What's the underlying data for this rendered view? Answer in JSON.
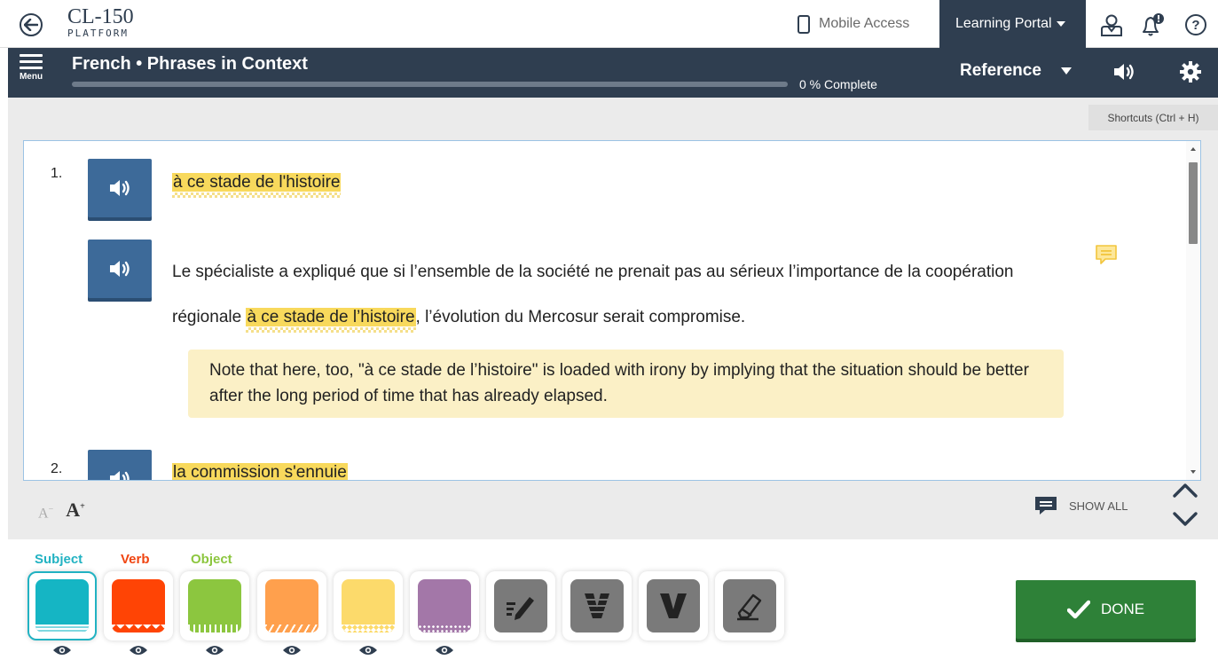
{
  "app": {
    "logo_main": "CL-150",
    "logo_sub": "PLATFORM",
    "mobile_access": "Mobile Access",
    "learning_portal": "Learning Portal"
  },
  "title_bar": {
    "menu_label": "Menu",
    "course_title": "French • Phrases in Context",
    "progress_percent": 0,
    "progress_text": "0 % Complete",
    "reference_label": "Reference"
  },
  "workspace": {
    "shortcuts": "Shortcuts (Ctrl + H)",
    "items": [
      {
        "number": "1.",
        "phrase": "à ce stade de l'histoire",
        "sentence_before": "Le spécialiste a expliqué que si l’ensemble de la société ne prenait pas au sérieux l’importance de la coopération régionale ",
        "sentence_highlight": "à ce stade de l’histoire",
        "sentence_after": ", l’évolution du Mercosur serait compromise.",
        "note": "Note that here, too, \"à ce stade de l’histoire\" is loaded with irony by implying that the situation should be better after the long period of time that has already elapsed."
      },
      {
        "number": "2.",
        "phrase": "la commission s'ennuie"
      }
    ],
    "font_decrease": "A",
    "font_increase": "A",
    "font_decrease_sup": "−",
    "font_increase_sup": "+",
    "show_all": "SHOW ALL"
  },
  "toolbar": {
    "labels": {
      "subject": "Subject",
      "verb": "Verb",
      "object": "Object"
    },
    "label_colors": {
      "subject": "#21b2c2",
      "verb": "#f04410",
      "object": "#8cc63f"
    },
    "swatches": [
      "#15b5c4",
      "#ff4405",
      "#8cc63f",
      "#ffa04d",
      "#fcda6b",
      "#a377a8"
    ],
    "tools": [
      "pencil-icon",
      "v-striped-icon",
      "v-bold-icon",
      "eraser-icon"
    ],
    "done_label": "DONE"
  }
}
